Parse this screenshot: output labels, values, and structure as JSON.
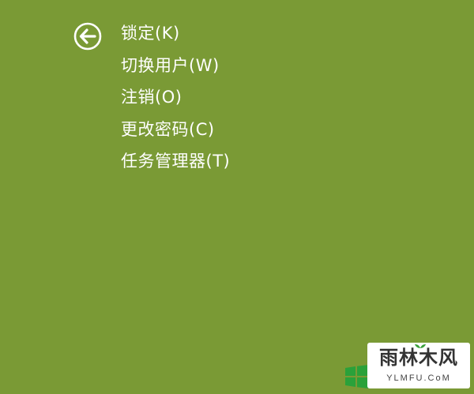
{
  "colors": {
    "background": "#7a9a35",
    "text": "#ffffff",
    "windows_logo": "#2aa13a"
  },
  "back_button": {
    "icon": "arrow-left-circle-icon"
  },
  "menu": {
    "items": [
      {
        "label": "锁定(K)"
      },
      {
        "label": "切换用户(W)"
      },
      {
        "label": "注销(O)"
      },
      {
        "label": "更改密码(C)"
      },
      {
        "label": "任务管理器(T)"
      }
    ]
  },
  "watermark": {
    "title": "雨林木风",
    "url": "YLMFU.CoM"
  },
  "windows_logo": {
    "icon": "windows-logo-icon"
  }
}
